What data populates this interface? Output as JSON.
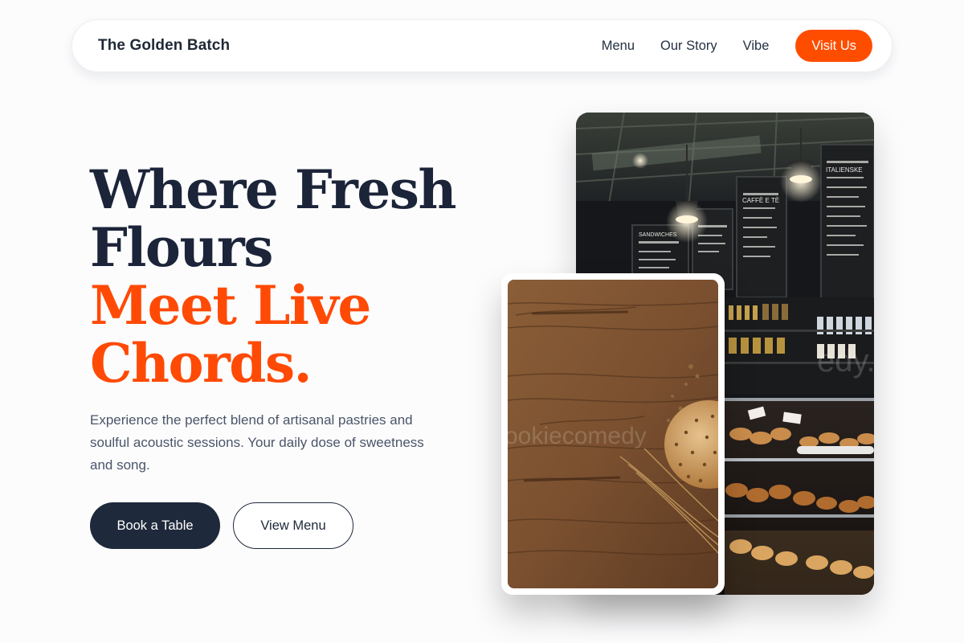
{
  "nav": {
    "brand": "The Golden Batch",
    "links": [
      "Menu",
      "Our Story",
      "Vibe"
    ],
    "cta": "Visit Us"
  },
  "hero": {
    "title_line1": "Where Fresh",
    "title_line2": "Flours",
    "title_line3": "Meet Live",
    "title_line4": "Chords.",
    "description": "Experience the perfect blend of artisanal pastries and soulful acoustic sessions. Your daily dose of sweetness and song.",
    "primary_button": "Book a Table",
    "secondary_button": "View Menu"
  },
  "photos": {
    "bakery_watermark": "edy.co",
    "wood_watermark": "ookiecomedy",
    "menu_board_1": "ITALIENSKE",
    "menu_board_2": "CAFFÈ E TÈ",
    "menu_board_3": "SANDWICHES"
  },
  "colors": {
    "accent": "#ff4d00",
    "dark": "#1e293b",
    "background": "#fcfcfd"
  }
}
